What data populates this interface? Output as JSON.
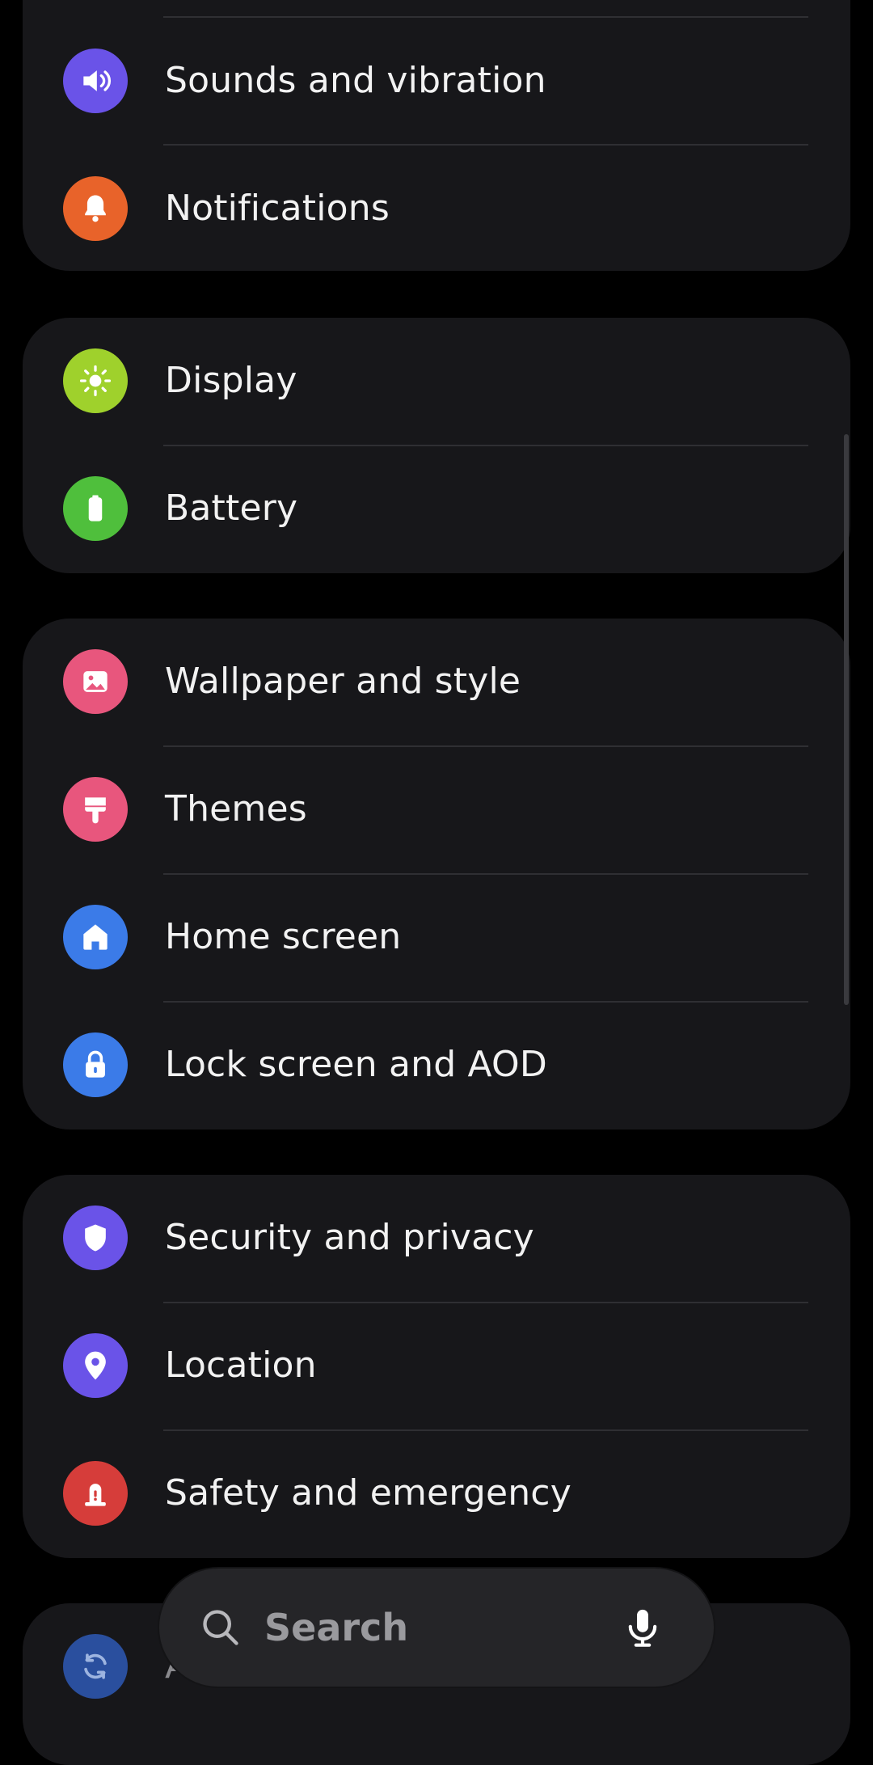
{
  "colors": {
    "background": "#000000",
    "card": "#17171a",
    "divider": "#2f2f33",
    "sounds_icon": "#6a53e8",
    "notifications_icon": "#e8632a",
    "display_icon": "#9fd12c",
    "battery_icon": "#4fbf3c",
    "wallpaper_icon": "#e8567d",
    "themes_icon": "#e8567d",
    "home_icon": "#3b7be8",
    "lock_icon": "#3b7be8",
    "security_icon": "#6a53e8",
    "location_icon": "#6a53e8",
    "safety_icon": "#d63d3a",
    "accounts_icon": "#2a4f9e"
  },
  "groups": [
    {
      "items": [
        {
          "label": "Sounds and vibration",
          "icon": "speaker-icon"
        },
        {
          "label": "Notifications",
          "icon": "bell-icon"
        }
      ]
    },
    {
      "items": [
        {
          "label": "Display",
          "icon": "sun-icon"
        },
        {
          "label": "Battery",
          "icon": "battery-icon"
        }
      ]
    },
    {
      "items": [
        {
          "label": "Wallpaper and style",
          "icon": "image-icon"
        },
        {
          "label": "Themes",
          "icon": "paint-brush-icon"
        },
        {
          "label": "Home screen",
          "icon": "home-icon"
        },
        {
          "label": "Lock screen and AOD",
          "icon": "lock-icon"
        }
      ]
    },
    {
      "items": [
        {
          "label": "Security and privacy",
          "icon": "shield-icon"
        },
        {
          "label": "Location",
          "icon": "location-pin-icon"
        },
        {
          "label": "Safety and emergency",
          "icon": "emergency-icon"
        }
      ]
    },
    {
      "items": [
        {
          "label": "A",
          "icon": "sync-icon"
        }
      ]
    }
  ],
  "search": {
    "placeholder": "Search",
    "search_icon": "search-icon",
    "mic_icon": "mic-icon"
  }
}
